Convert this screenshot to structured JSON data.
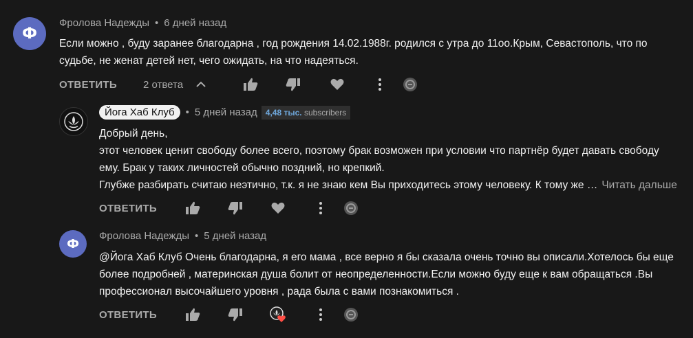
{
  "comments": [
    {
      "author": "Фролова Надежды",
      "time": "6 дней назад",
      "avatar_letter": "Ф",
      "lines": [
        "Если можно , буду заранее благодарна , год рождения 14.02.1988г. родился с утра до 11оо.Крым, Севастополь, что по",
        "судьбе, не женат детей нет, чего ожидать, на что надеяться."
      ],
      "reply_label": "ОТВЕТИТЬ",
      "replies_label": "2 ответа"
    },
    {
      "author": "Йога Хаб Клуб",
      "time": "5 дней назад",
      "subs_count": "4,48 тыс.",
      "subs_label": "subscribers",
      "lines": [
        "Добрый день,",
        "этот человек ценит свободу более всего, поэтому брак возможен при условии что партнёр будет давать свободу",
        "ему. Брак у таких личностей обычно поздний, но крепкий.",
        "Глубже разбирать считаю неэтично, т.к. я не знаю кем Вы приходитесь этому человеку. К тому же …"
      ],
      "read_more": "Читать дальше",
      "reply_label": "ОТВЕТИТЬ"
    },
    {
      "author": "Фролова Надежды",
      "time": "5 дней назад",
      "avatar_letter": "Ф",
      "lines": [
        " @Йога Хаб Клуб  Очень благодарна, я его мама , все верно я бы сказала очень точно вы описали.Хотелось бы еще",
        "более подробней , материнская душа болит от неопределенности.Если можно буду еще к вам обращаться .Вы",
        "профессионал высочайшего уровня , рада была с вами познакомиться ."
      ],
      "reply_label": "ОТВЕТИТЬ"
    }
  ],
  "colors": {
    "background": "#181818",
    "avatar": "#5c6bc0",
    "heart": "#ff4e45",
    "subs_accent": "#6fa8dc"
  }
}
